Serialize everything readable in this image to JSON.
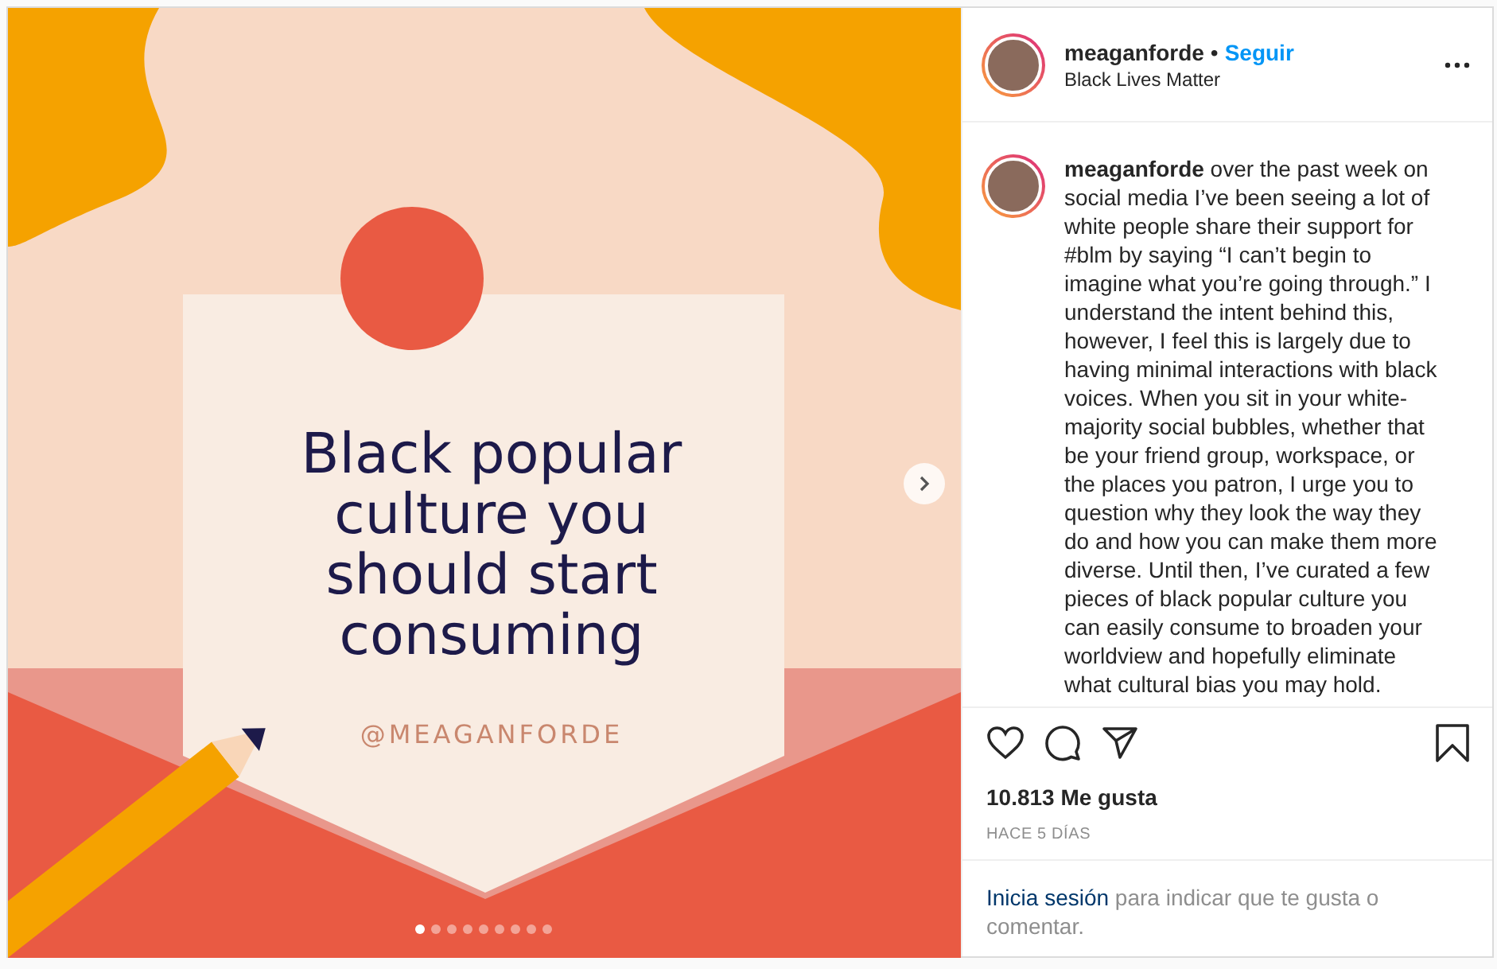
{
  "post_image": {
    "headline_lines": [
      "Black popular",
      "culture you",
      "should start",
      "consuming"
    ],
    "handle": "@MEAGANFORDE",
    "slides": [
      {
        "selected": true
      },
      {
        "selected": false
      },
      {
        "selected": false
      },
      {
        "selected": false
      },
      {
        "selected": false
      },
      {
        "selected": false
      },
      {
        "selected": false
      },
      {
        "selected": false
      },
      {
        "selected": false
      }
    ]
  },
  "header": {
    "username": "meaganforde",
    "separator": "•",
    "follow": "Seguir",
    "subtitle": "Black Lives Matter"
  },
  "caption": {
    "username": "meaganforde",
    "text": "over the past week on social media I’ve been seeing a lot of white people share their support for #blm by saying “I can’t begin to imagine what you’re going through.” I understand the intent behind this, however, I feel this is largely due to having minimal interactions with black voices. When you sit in your white-majority social bubbles, whether that be your friend group, workspace, or the places you patron, I urge you to question why they look the way they do and how you can make them more diverse. Until then, I’ve curated a few pieces of black popular culture you can easily consume to broaden your worldview and hopefully eliminate what cultural bias you may hold."
  },
  "likes": "10.813 Me gusta",
  "time": "HACE 5 DÍAS",
  "login": {
    "link": "Inicia sesión",
    "text": "para indicar que te gusta o comentar."
  }
}
